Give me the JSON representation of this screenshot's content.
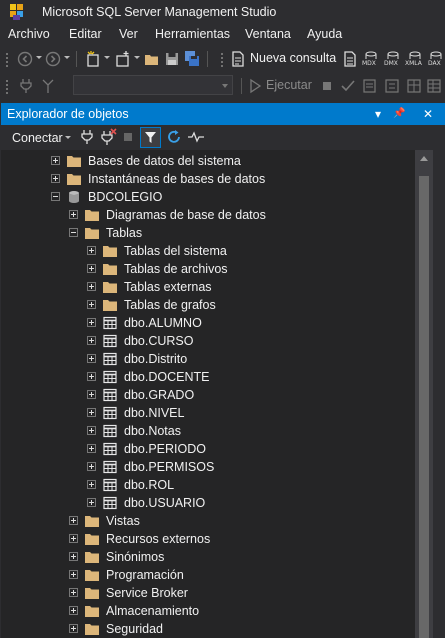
{
  "window": {
    "title": "Microsoft SQL Server Management Studio"
  },
  "menu": [
    "Archivo",
    "Editar",
    "Ver",
    "Herramientas",
    "Ventana",
    "Ayuda"
  ],
  "toolbar": {
    "new_query_label": "Nueva consulta",
    "mini_icons": [
      "MDX",
      "DMX",
      "XMLA",
      "DAX"
    ],
    "execute_label": "Ejecutar"
  },
  "object_explorer": {
    "title": "Explorador de objetos",
    "title_controls": {
      "dropdown": "▾",
      "pin": "📌",
      "close": "✕"
    },
    "connect_label": "Conectar",
    "tree": [
      {
        "label": "Bases de datos del sistema",
        "icon": "folder-icon",
        "expander": "plus"
      },
      {
        "label": "Instantáneas de bases de datos",
        "icon": "folder-icon",
        "expander": "plus"
      },
      {
        "label": "BDCOLEGIO",
        "icon": "database-icon",
        "expander": "minus"
      },
      {
        "label": "Diagramas de base de datos",
        "icon": "folder-icon",
        "expander": "plus"
      },
      {
        "label": "Tablas",
        "icon": "folder-icon",
        "expander": "minus"
      },
      {
        "label": "Tablas del sistema",
        "icon": "folder-icon",
        "expander": "plus"
      },
      {
        "label": "Tablas de archivos",
        "icon": "folder-icon",
        "expander": "plus"
      },
      {
        "label": "Tablas externas",
        "icon": "folder-icon",
        "expander": "plus"
      },
      {
        "label": "Tablas de grafos",
        "icon": "folder-icon",
        "expander": "plus"
      },
      {
        "label": "dbo.ALUMNO",
        "icon": "table-icon",
        "expander": "plus"
      },
      {
        "label": "dbo.CURSO",
        "icon": "table-icon",
        "expander": "plus"
      },
      {
        "label": "dbo.Distrito",
        "icon": "table-icon",
        "expander": "plus"
      },
      {
        "label": "dbo.DOCENTE",
        "icon": "table-icon",
        "expander": "plus"
      },
      {
        "label": "dbo.GRADO",
        "icon": "table-icon",
        "expander": "plus"
      },
      {
        "label": "dbo.NIVEL",
        "icon": "table-icon",
        "expander": "plus"
      },
      {
        "label": "dbo.Notas",
        "icon": "table-icon",
        "expander": "plus"
      },
      {
        "label": "dbo.PERIODO",
        "icon": "table-icon",
        "expander": "plus"
      },
      {
        "label": "dbo.PERMISOS",
        "icon": "table-icon",
        "expander": "plus"
      },
      {
        "label": "dbo.ROL",
        "icon": "table-icon",
        "expander": "plus"
      },
      {
        "label": "dbo.USUARIO",
        "icon": "table-icon",
        "expander": "plus"
      },
      {
        "label": "Vistas",
        "icon": "folder-icon",
        "expander": "plus"
      },
      {
        "label": "Recursos externos",
        "icon": "folder-icon",
        "expander": "plus"
      },
      {
        "label": "Sinónimos",
        "icon": "folder-icon",
        "expander": "plus"
      },
      {
        "label": "Programación",
        "icon": "folder-icon",
        "expander": "plus"
      },
      {
        "label": "Service Broker",
        "icon": "folder-icon",
        "expander": "plus"
      },
      {
        "label": "Almacenamiento",
        "icon": "folder-icon",
        "expander": "plus"
      },
      {
        "label": "Seguridad",
        "icon": "folder-icon",
        "expander": "plus"
      }
    ]
  },
  "colors": {
    "background": "#2d2d30",
    "tree_background": "#252526",
    "accent": "#007acc",
    "folder": "#dcb67a",
    "text": "#f1f1f1"
  }
}
